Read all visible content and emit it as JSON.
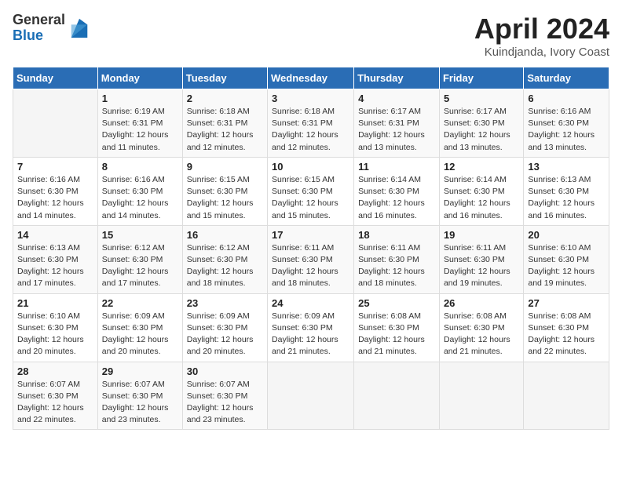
{
  "header": {
    "logo_general": "General",
    "logo_blue": "Blue",
    "month_title": "April 2024",
    "location": "Kuindjanda, Ivory Coast"
  },
  "days_of_week": [
    "Sunday",
    "Monday",
    "Tuesday",
    "Wednesday",
    "Thursday",
    "Friday",
    "Saturday"
  ],
  "weeks": [
    [
      {
        "day": "",
        "info": ""
      },
      {
        "day": "1",
        "info": "Sunrise: 6:19 AM\nSunset: 6:31 PM\nDaylight: 12 hours\nand 11 minutes."
      },
      {
        "day": "2",
        "info": "Sunrise: 6:18 AM\nSunset: 6:31 PM\nDaylight: 12 hours\nand 12 minutes."
      },
      {
        "day": "3",
        "info": "Sunrise: 6:18 AM\nSunset: 6:31 PM\nDaylight: 12 hours\nand 12 minutes."
      },
      {
        "day": "4",
        "info": "Sunrise: 6:17 AM\nSunset: 6:31 PM\nDaylight: 12 hours\nand 13 minutes."
      },
      {
        "day": "5",
        "info": "Sunrise: 6:17 AM\nSunset: 6:30 PM\nDaylight: 12 hours\nand 13 minutes."
      },
      {
        "day": "6",
        "info": "Sunrise: 6:16 AM\nSunset: 6:30 PM\nDaylight: 12 hours\nand 13 minutes."
      }
    ],
    [
      {
        "day": "7",
        "info": "Sunrise: 6:16 AM\nSunset: 6:30 PM\nDaylight: 12 hours\nand 14 minutes."
      },
      {
        "day": "8",
        "info": "Sunrise: 6:16 AM\nSunset: 6:30 PM\nDaylight: 12 hours\nand 14 minutes."
      },
      {
        "day": "9",
        "info": "Sunrise: 6:15 AM\nSunset: 6:30 PM\nDaylight: 12 hours\nand 15 minutes."
      },
      {
        "day": "10",
        "info": "Sunrise: 6:15 AM\nSunset: 6:30 PM\nDaylight: 12 hours\nand 15 minutes."
      },
      {
        "day": "11",
        "info": "Sunrise: 6:14 AM\nSunset: 6:30 PM\nDaylight: 12 hours\nand 16 minutes."
      },
      {
        "day": "12",
        "info": "Sunrise: 6:14 AM\nSunset: 6:30 PM\nDaylight: 12 hours\nand 16 minutes."
      },
      {
        "day": "13",
        "info": "Sunrise: 6:13 AM\nSunset: 6:30 PM\nDaylight: 12 hours\nand 16 minutes."
      }
    ],
    [
      {
        "day": "14",
        "info": "Sunrise: 6:13 AM\nSunset: 6:30 PM\nDaylight: 12 hours\nand 17 minutes."
      },
      {
        "day": "15",
        "info": "Sunrise: 6:12 AM\nSunset: 6:30 PM\nDaylight: 12 hours\nand 17 minutes."
      },
      {
        "day": "16",
        "info": "Sunrise: 6:12 AM\nSunset: 6:30 PM\nDaylight: 12 hours\nand 18 minutes."
      },
      {
        "day": "17",
        "info": "Sunrise: 6:11 AM\nSunset: 6:30 PM\nDaylight: 12 hours\nand 18 minutes."
      },
      {
        "day": "18",
        "info": "Sunrise: 6:11 AM\nSunset: 6:30 PM\nDaylight: 12 hours\nand 18 minutes."
      },
      {
        "day": "19",
        "info": "Sunrise: 6:11 AM\nSunset: 6:30 PM\nDaylight: 12 hours\nand 19 minutes."
      },
      {
        "day": "20",
        "info": "Sunrise: 6:10 AM\nSunset: 6:30 PM\nDaylight: 12 hours\nand 19 minutes."
      }
    ],
    [
      {
        "day": "21",
        "info": "Sunrise: 6:10 AM\nSunset: 6:30 PM\nDaylight: 12 hours\nand 20 minutes."
      },
      {
        "day": "22",
        "info": "Sunrise: 6:09 AM\nSunset: 6:30 PM\nDaylight: 12 hours\nand 20 minutes."
      },
      {
        "day": "23",
        "info": "Sunrise: 6:09 AM\nSunset: 6:30 PM\nDaylight: 12 hours\nand 20 minutes."
      },
      {
        "day": "24",
        "info": "Sunrise: 6:09 AM\nSunset: 6:30 PM\nDaylight: 12 hours\nand 21 minutes."
      },
      {
        "day": "25",
        "info": "Sunrise: 6:08 AM\nSunset: 6:30 PM\nDaylight: 12 hours\nand 21 minutes."
      },
      {
        "day": "26",
        "info": "Sunrise: 6:08 AM\nSunset: 6:30 PM\nDaylight: 12 hours\nand 21 minutes."
      },
      {
        "day": "27",
        "info": "Sunrise: 6:08 AM\nSunset: 6:30 PM\nDaylight: 12 hours\nand 22 minutes."
      }
    ],
    [
      {
        "day": "28",
        "info": "Sunrise: 6:07 AM\nSunset: 6:30 PM\nDaylight: 12 hours\nand 22 minutes."
      },
      {
        "day": "29",
        "info": "Sunrise: 6:07 AM\nSunset: 6:30 PM\nDaylight: 12 hours\nand 23 minutes."
      },
      {
        "day": "30",
        "info": "Sunrise: 6:07 AM\nSunset: 6:30 PM\nDaylight: 12 hours\nand 23 minutes."
      },
      {
        "day": "",
        "info": ""
      },
      {
        "day": "",
        "info": ""
      },
      {
        "day": "",
        "info": ""
      },
      {
        "day": "",
        "info": ""
      }
    ]
  ]
}
